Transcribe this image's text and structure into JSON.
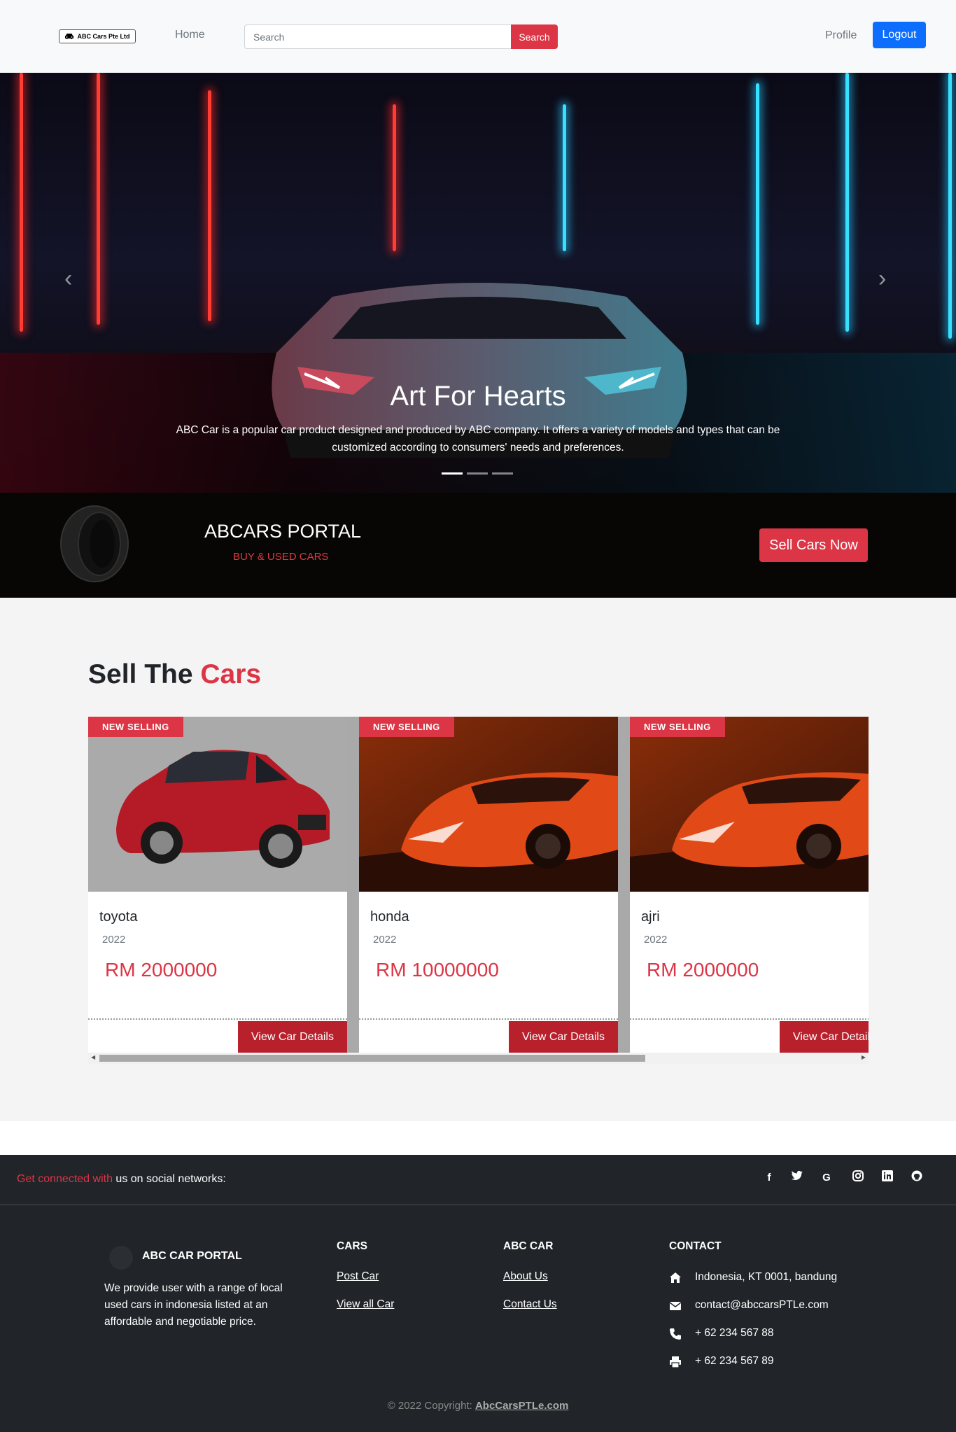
{
  "navbar": {
    "brand": "ABC Cars Pte Ltd",
    "home": "Home",
    "search_placeholder": "Search",
    "search_button": "Search",
    "profile": "Profile",
    "logout": "Logout"
  },
  "hero": {
    "title": "Art For Hearts",
    "text": "ABC Car is a popular car product designed and produced by ABC company. It offers a variety of models and types that can be customized according to consumers' needs and preferences.",
    "prev_icon": "chevron-left-icon",
    "next_icon": "chevron-right-icon",
    "active_slide": 1,
    "slide_count": 3
  },
  "portal": {
    "title": "ABCARS PORTAL",
    "subtitle": "BUY & USED CARS",
    "sell_button": "Sell Cars Now"
  },
  "section": {
    "title_part1": "Sell The",
    "title_part2": "Cars"
  },
  "cars": [
    {
      "badge": "NEW SELLING",
      "name": "toyota",
      "year": "2022",
      "price": "RM 2000000",
      "button": "View Car Details",
      "image": "red-hatchback"
    },
    {
      "badge": "NEW SELLING",
      "name": "honda",
      "year": "2022",
      "price": "RM 10000000",
      "button": "View Car Details",
      "image": "orange-supercar"
    },
    {
      "badge": "NEW SELLING",
      "name": "ajri",
      "year": "2022",
      "price": "RM 2000000",
      "button": "View Car Details",
      "image": "orange-supercar"
    }
  ],
  "social": {
    "text_red": "Get connected with",
    "text_white": " us on social networks:",
    "icons": [
      "facebook-icon",
      "twitter-icon",
      "google-icon",
      "instagram-icon",
      "linkedin-icon",
      "github-icon"
    ]
  },
  "footer": {
    "brand": "ABC CAR PORTAL",
    "description": "We provide user with a range of local used cars in indonesia listed at an affordable and negotiable price.",
    "cars_heading": "CARS",
    "cars_links": [
      "Post Car",
      "View all Car"
    ],
    "abc_heading": "ABC CAR",
    "abc_links": [
      "About Us",
      "Contact Us"
    ],
    "contact_heading": "CONTACT",
    "contact_items": [
      {
        "icon": "home-icon",
        "text": "Indonesia, KT 0001, bandung"
      },
      {
        "icon": "envelope-icon",
        "text": "contact@abccarsPTLe.com"
      },
      {
        "icon": "phone-icon",
        "text": "+ 62 234 567 88"
      },
      {
        "icon": "print-icon",
        "text": "+ 62 234 567 89"
      }
    ],
    "copyright_prefix": "© 2022 Copyright: ",
    "copyright_link": "AbcCarsPTLe.com"
  },
  "colors": {
    "accent_red": "#dc3545",
    "logout_blue": "#0d6efd",
    "footer_bg": "#212529"
  }
}
